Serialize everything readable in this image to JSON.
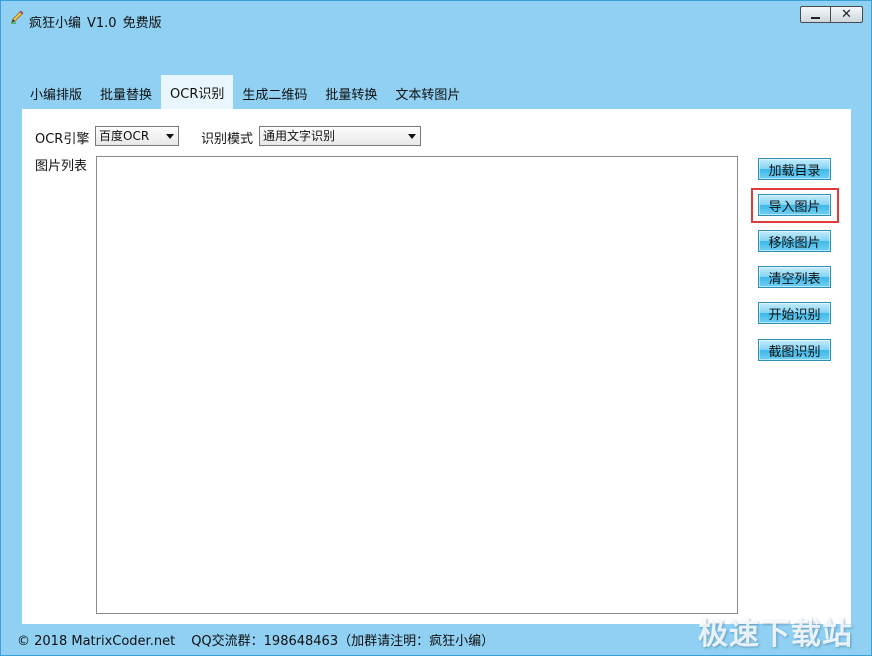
{
  "titlebar": {
    "app_name": "疯狂小编",
    "version": "V1.0",
    "edition": "免费版",
    "icon": "pencil-icon"
  },
  "window_controls": {
    "minimize_icon": "minimize-icon",
    "close_icon": "close-icon",
    "close_glyph": "✕"
  },
  "tabs": [
    {
      "label": "小编排版",
      "active": false
    },
    {
      "label": "批量替换",
      "active": false
    },
    {
      "label": "OCR识别",
      "active": true
    },
    {
      "label": "生成二维码",
      "active": false
    },
    {
      "label": "批量转换",
      "active": false
    },
    {
      "label": "文本转图片",
      "active": false
    }
  ],
  "ocr_panel": {
    "engine_label": "OCR引擎",
    "engine_value": "百度OCR",
    "mode_label": "识别模式",
    "mode_value": "通用文字识别",
    "image_list_label": "图片列表",
    "buttons": {
      "load_dir": "加载目录",
      "import_image": "导入图片",
      "remove_image": "移除图片",
      "clear_list": "清空列表",
      "start_recognition": "开始识别",
      "screenshot_recognition": "截图识别"
    }
  },
  "statusbar": {
    "copyright": "© 2018 MatrixCoder.net",
    "qq_group": "QQ交流群：198648463（加群请注明：疯狂小编）"
  },
  "watermark": "极速下载站",
  "colors": {
    "window_bg": "#8fd0f3",
    "panel_bg": "#ffffff",
    "button_accent": "#3fb8e8",
    "highlight": "#e03a3a"
  }
}
